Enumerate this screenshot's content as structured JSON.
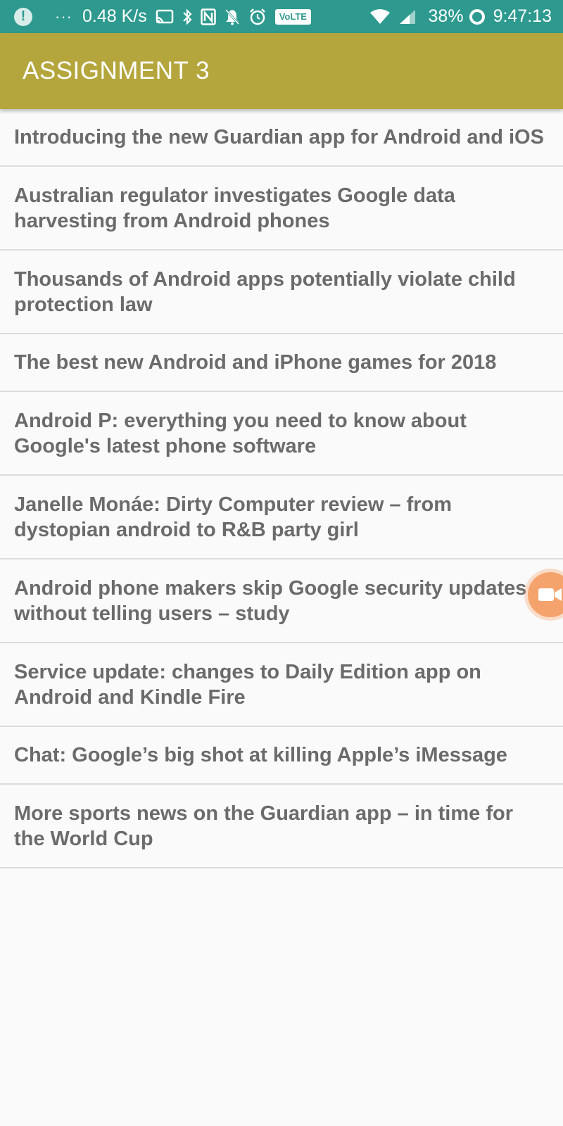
{
  "status_bar": {
    "dots": "···",
    "speed": "0.48 K/s",
    "volte": "VoLTE",
    "battery": "38%",
    "time": "9:47:13"
  },
  "app_bar": {
    "title": "ASSIGNMENT 3"
  },
  "articles": [
    {
      "title": "Introducing the new Guardian app for Android and iOS"
    },
    {
      "title": "Australian regulator investigates Google data harvesting from Android phones"
    },
    {
      "title": "Thousands of Android apps potentially violate child protection law"
    },
    {
      "title": "The best new Android and iPhone games for 2018"
    },
    {
      "title": "Android P: everything you need to know about Google's latest phone software"
    },
    {
      "title": "Janelle Monáe: Dirty Computer review – from dystopian android to R&B party girl"
    },
    {
      "title": "Android phone makers skip Google security updates without telling users – study"
    },
    {
      "title": "Service update: changes to Daily Edition app on Android and Kindle Fire"
    },
    {
      "title": "Chat: Google’s big shot at killing Apple’s iMessage"
    },
    {
      "title": "More sports news on the Guardian app – in time for the World Cup"
    }
  ],
  "colors": {
    "status_bar": "#2e9a8f",
    "app_bar": "#b4a63c",
    "list_text": "#6b6b6b",
    "floating_button": "#f5a36c"
  },
  "icons": {
    "floating_button": "video-camera-icon"
  }
}
